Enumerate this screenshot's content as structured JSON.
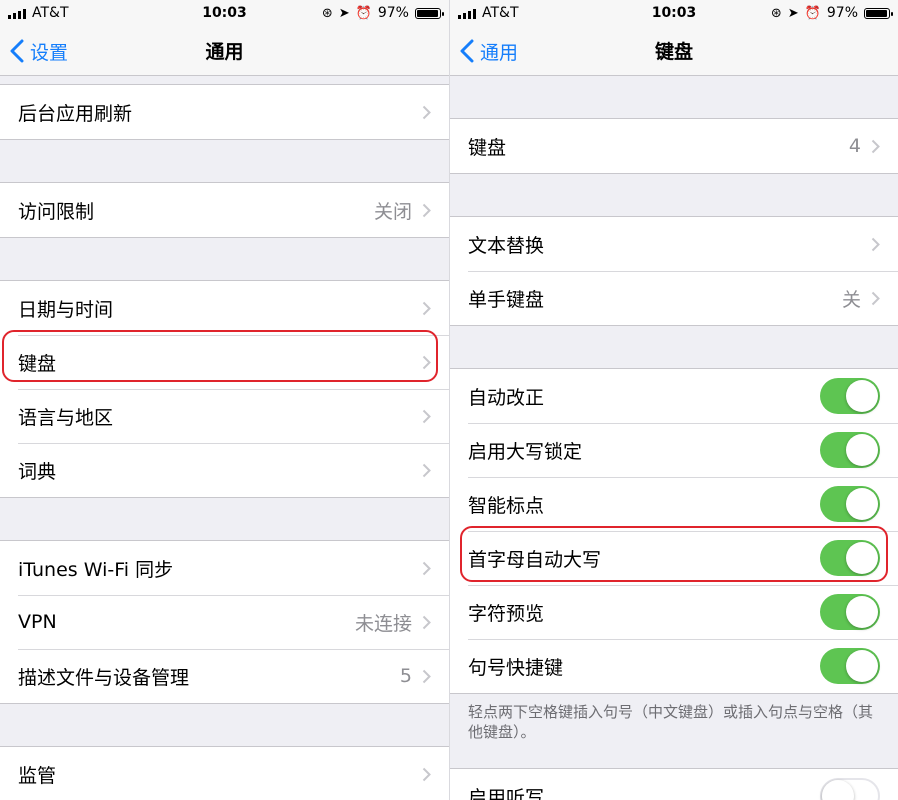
{
  "status": {
    "carrier": "AT&T",
    "time": "10:03",
    "battery": "97%",
    "battery_level": 0.97
  },
  "left": {
    "back_label": "设置",
    "title": "通用",
    "groups": [
      [
        {
          "label": "后台应用刷新",
          "value": ""
        }
      ],
      [
        {
          "label": "访问限制",
          "value": "关闭"
        }
      ],
      [
        {
          "label": "日期与时间",
          "value": ""
        },
        {
          "label": "键盘",
          "value": ""
        },
        {
          "label": "语言与地区",
          "value": ""
        },
        {
          "label": "词典",
          "value": ""
        }
      ],
      [
        {
          "label": "iTunes Wi-Fi 同步",
          "value": ""
        },
        {
          "label": "VPN",
          "value": "未连接"
        },
        {
          "label": "描述文件与设备管理",
          "value": "5"
        }
      ],
      [
        {
          "label": "监管",
          "value": ""
        }
      ]
    ]
  },
  "right": {
    "back_label": "通用",
    "title": "键盘",
    "keyboards": {
      "label": "键盘",
      "value": "4"
    },
    "text_replacement": {
      "label": "文本替换"
    },
    "one_handed": {
      "label": "单手键盘",
      "value": "关"
    },
    "toggles": [
      {
        "label": "自动改正",
        "on": true
      },
      {
        "label": "启用大写锁定",
        "on": true
      },
      {
        "label": "智能标点",
        "on": true
      },
      {
        "label": "首字母自动大写",
        "on": true
      },
      {
        "label": "字符预览",
        "on": true
      },
      {
        "label": "句号快捷键",
        "on": true
      }
    ],
    "footnote": "轻点两下空格键插入句号（中文键盘）或插入句点与空格（其他键盘）。",
    "dictation": {
      "label": "启用听写",
      "on": false
    }
  },
  "colors": {
    "accent": "#157efb",
    "switch_on": "#5ec552",
    "highlight": "#e0242c"
  }
}
